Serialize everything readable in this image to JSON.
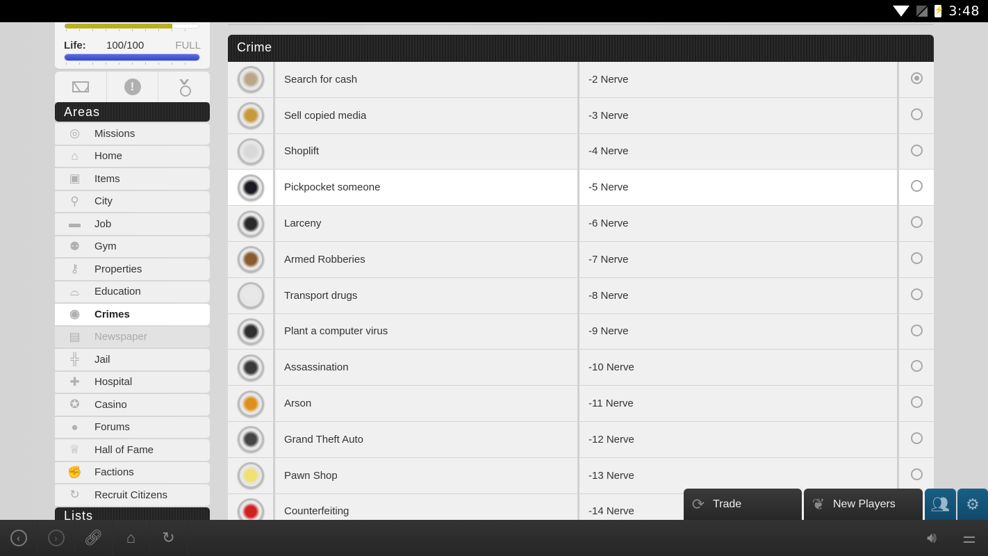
{
  "status_bar": {
    "time": "3:48",
    "icons": [
      "wifi-icon",
      "no-signal-icon",
      "battery-charging-icon"
    ]
  },
  "stats": {
    "top_bar_fraction": 0.8,
    "life": {
      "label": "Life:",
      "value": "100/100",
      "status": "FULL",
      "fraction": 1.0
    }
  },
  "icon_tray": [
    "mail-icon",
    "alert-icon",
    "medal-icon"
  ],
  "sidebar": {
    "areas_title": "Areas",
    "items": [
      {
        "label": "Missions",
        "icon": "target-icon",
        "glyph": "◎",
        "state": "normal"
      },
      {
        "label": "Home",
        "icon": "home-icon",
        "glyph": "⌂",
        "state": "normal"
      },
      {
        "label": "Items",
        "icon": "box-icon",
        "glyph": "▣",
        "state": "normal"
      },
      {
        "label": "City",
        "icon": "map-pin-icon",
        "glyph": "⚲",
        "state": "normal"
      },
      {
        "label": "Job",
        "icon": "briefcase-icon",
        "glyph": "▬",
        "state": "normal"
      },
      {
        "label": "Gym",
        "icon": "weightlifter-icon",
        "glyph": "⚉",
        "state": "normal"
      },
      {
        "label": "Properties",
        "icon": "key-icon",
        "glyph": "⚷",
        "state": "normal"
      },
      {
        "label": "Education",
        "icon": "graduation-cap-icon",
        "glyph": "⌓",
        "state": "normal"
      },
      {
        "label": "Crimes",
        "icon": "fingerprint-icon",
        "glyph": "◉",
        "state": "active"
      },
      {
        "label": "Newspaper",
        "icon": "newspaper-icon",
        "glyph": "▤",
        "state": "disabled"
      },
      {
        "label": "Jail",
        "icon": "jail-bars-icon",
        "glyph": "╬",
        "state": "normal"
      },
      {
        "label": "Hospital",
        "icon": "cross-icon",
        "glyph": "✚",
        "state": "normal"
      },
      {
        "label": "Casino",
        "icon": "poker-chip-icon",
        "glyph": "✪",
        "state": "normal"
      },
      {
        "label": "Forums",
        "icon": "speech-bubble-icon",
        "glyph": "●",
        "state": "normal"
      },
      {
        "label": "Hall of Fame",
        "icon": "trophy-icon",
        "glyph": "♕",
        "state": "normal"
      },
      {
        "label": "Factions",
        "icon": "fist-icon",
        "glyph": "✊",
        "state": "normal"
      },
      {
        "label": "Recruit Citizens",
        "icon": "recycle-icon",
        "glyph": "↻",
        "state": "normal"
      }
    ],
    "lists_title": "Lists"
  },
  "crime_panel": {
    "title": "Crime",
    "selected_index": 0,
    "highlighted_index": 3,
    "rows": [
      {
        "name": "Search for cash",
        "cost": "-2 Nerve",
        "icon": "cash-icon",
        "color": "#b8a888"
      },
      {
        "name": "Sell copied media",
        "cost": "-3 Nerve",
        "icon": "disc-icon",
        "color": "#c89a3a"
      },
      {
        "name": "Shoplift",
        "cost": "-4 Nerve",
        "icon": "shoplift-icon",
        "color": "#d8d8d8"
      },
      {
        "name": "Pickpocket someone",
        "cost": "-5 Nerve",
        "icon": "hooded-figure-icon",
        "color": "#1a1a22"
      },
      {
        "name": "Larceny",
        "cost": "-6 Nerve",
        "icon": "mask-icon",
        "color": "#2a2a2a"
      },
      {
        "name": "Armed Robberies",
        "cost": "-7 Nerve",
        "icon": "gun-icon",
        "color": "#8a5a30"
      },
      {
        "name": "Transport drugs",
        "cost": "-8 Nerve",
        "icon": "van-icon",
        "color": "#e8e8e8"
      },
      {
        "name": "Plant a computer virus",
        "cost": "-9 Nerve",
        "icon": "floppy-disk-icon",
        "color": "#303030"
      },
      {
        "name": "Assassination",
        "cost": "-10 Nerve",
        "icon": "crosshair-icon",
        "color": "#3a3a3a"
      },
      {
        "name": "Arson",
        "cost": "-11 Nerve",
        "icon": "fire-icon",
        "color": "#e0901a"
      },
      {
        "name": "Grand Theft Auto",
        "cost": "-12 Nerve",
        "icon": "car-icon",
        "color": "#444444"
      },
      {
        "name": "Pawn Shop",
        "cost": "-13 Nerve",
        "icon": "sticky-note-icon",
        "color": "#f0e070"
      },
      {
        "name": "Counterfeiting",
        "cost": "-14 Nerve",
        "icon": "red-card-icon",
        "color": "#d02020"
      }
    ]
  },
  "bottom_tabs": {
    "trade": {
      "label": "Trade",
      "icon": "trade-icon"
    },
    "new_players": {
      "label": "New Players",
      "icon": "leaf-icon"
    },
    "friends": {
      "icon": "people-icon"
    },
    "settings": {
      "icon": "gear-icon"
    }
  },
  "nav_bar": {
    "left": [
      "back-icon",
      "forward-icon",
      "link-icon",
      "home-icon",
      "refresh-icon"
    ],
    "right": [
      "volume-icon",
      "equalizer-icon"
    ]
  }
}
